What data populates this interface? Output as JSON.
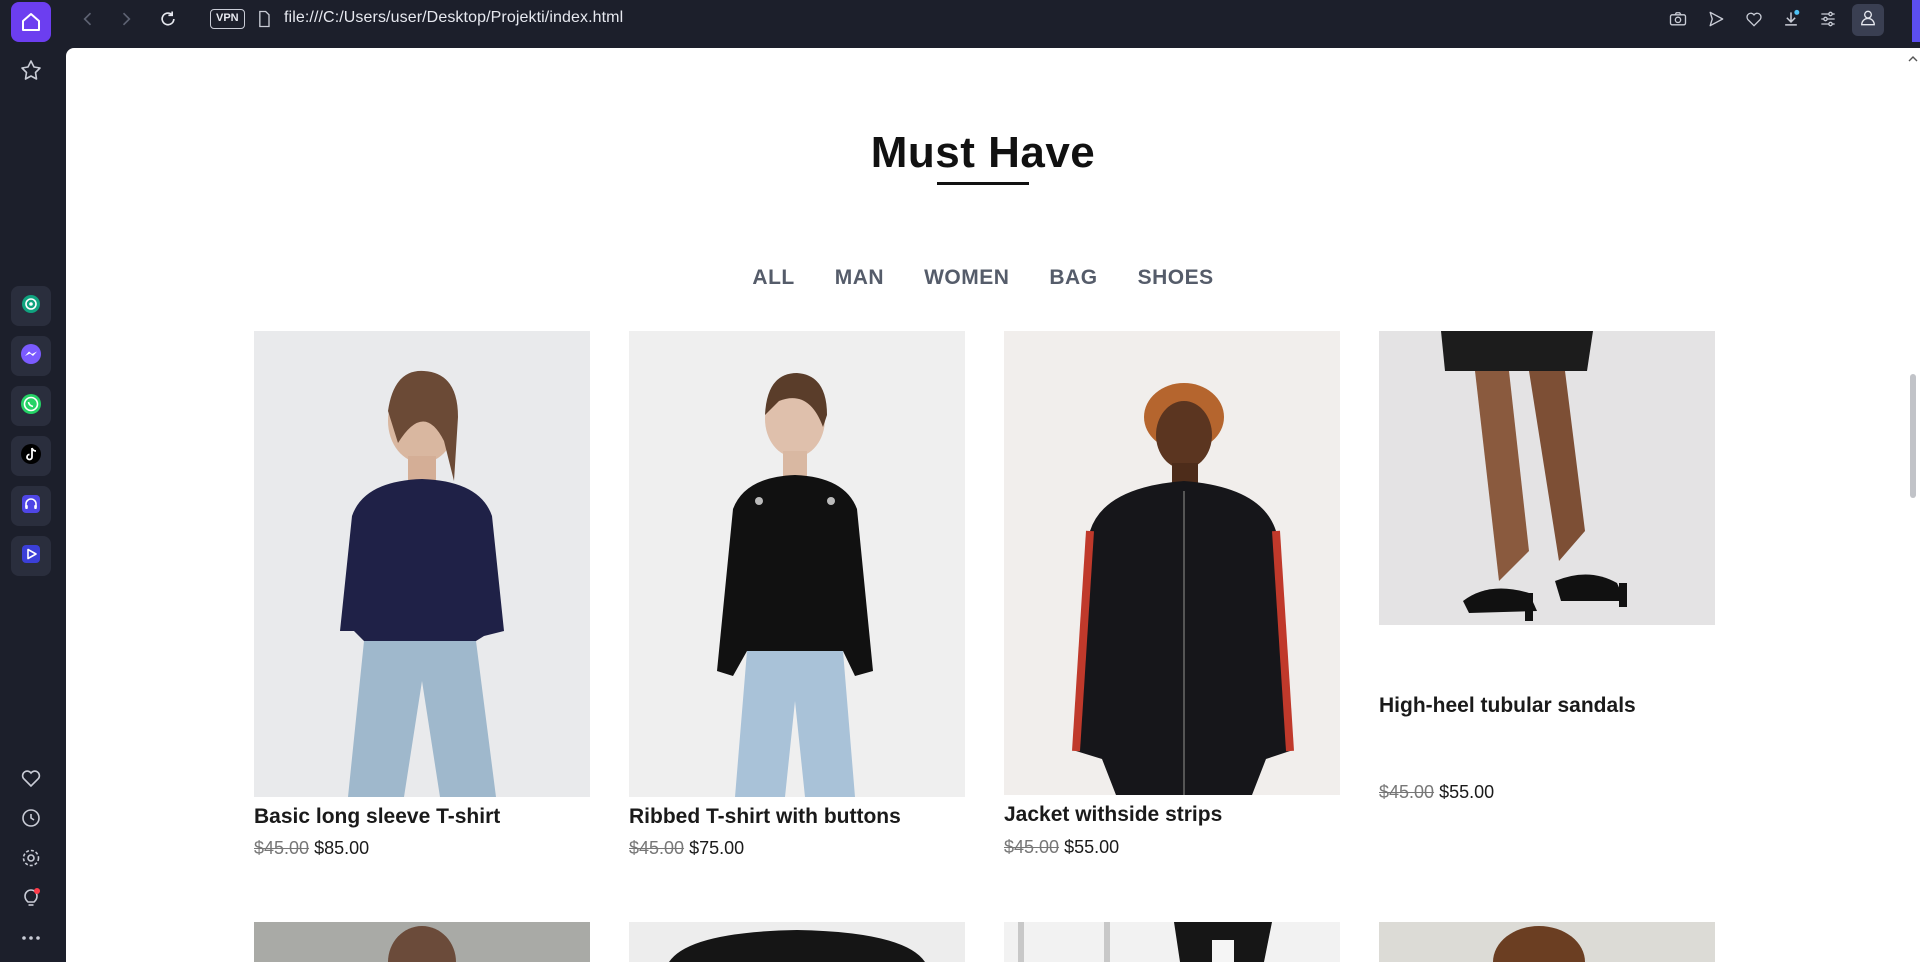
{
  "browser": {
    "url": "file:///C:/Users/user/Desktop/Projekti/index.html",
    "vpn_label": "VPN",
    "sidebar_icons": [
      "home-icon",
      "pin-icon",
      "chatgpt-icon",
      "messenger-icon",
      "whatsapp-icon",
      "tiktok-icon",
      "music-player-icon",
      "video-player-icon",
      "heart-icon",
      "history-icon",
      "settings-icon",
      "lightbulb-icon",
      "more-icon"
    ],
    "toolbar_icons": [
      "camera-icon",
      "send-icon",
      "heart-icon",
      "download-icon",
      "easy-setup-icon",
      "profile-icon"
    ],
    "accent_color": "#5b4ef0"
  },
  "page": {
    "section_title": "Must Have",
    "filters": [
      "ALL",
      "MAN",
      "WOMEN",
      "BAG",
      "SHOES"
    ],
    "products": [
      {
        "name": "Basic long sleeve T-shirt",
        "old_price": "$45.00",
        "new_price": "$85.00"
      },
      {
        "name": "Ribbed T-shirt with buttons",
        "old_price": "$45.00",
        "new_price": "$75.00"
      },
      {
        "name": "Jacket withside strips",
        "old_price": "$45.00",
        "new_price": "$55.00"
      },
      {
        "name": "High-heel tubular sandals",
        "old_price": "$45.00",
        "new_price": "$55.00"
      }
    ]
  }
}
